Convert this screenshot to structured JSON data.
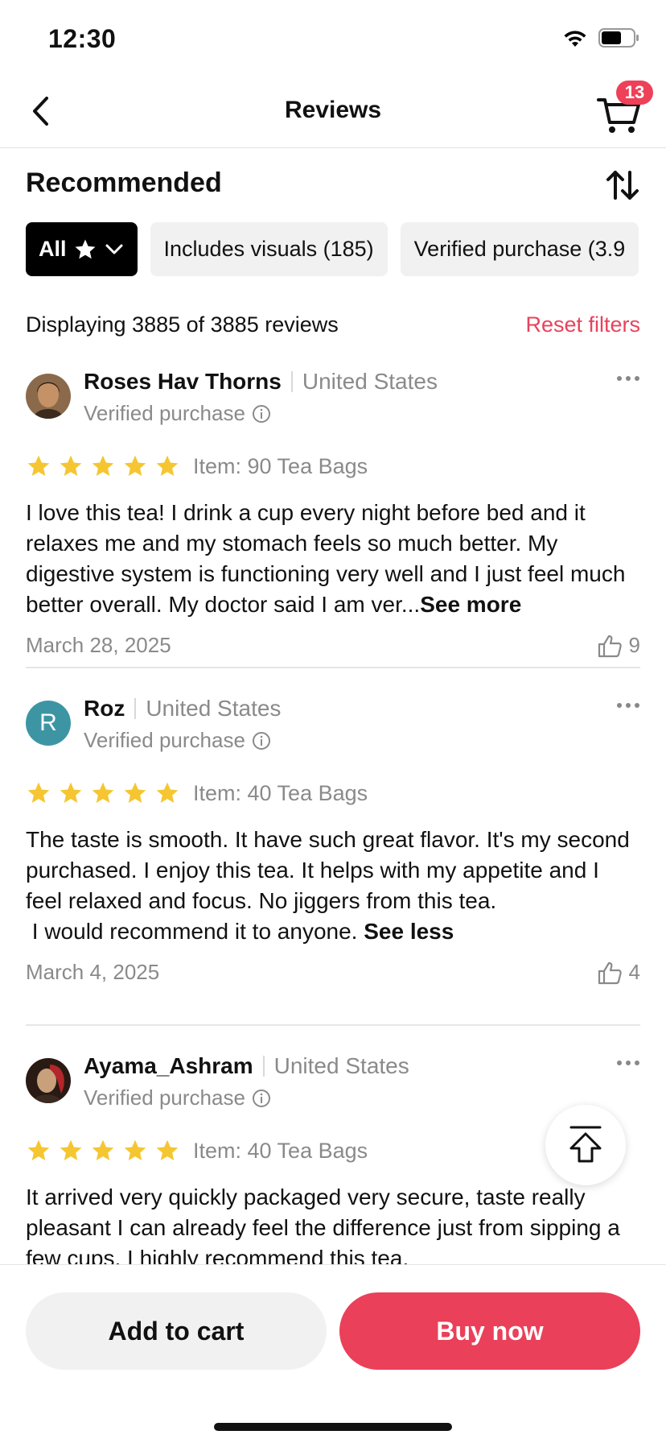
{
  "status": {
    "time": "12:30"
  },
  "nav": {
    "title": "Reviews",
    "cart_count": "13"
  },
  "sort": {
    "title": "Recommended"
  },
  "filters": [
    {
      "label": "All",
      "active": true
    },
    {
      "label": "Includes visuals (185)",
      "active": false
    },
    {
      "label": "Verified purchase (3.9",
      "active": false
    }
  ],
  "summary": {
    "text": "Displaying 3885 of 3885 reviews",
    "reset_label": "Reset filters"
  },
  "reviews": [
    {
      "name": "Roses Hav Thorns",
      "country": "United States",
      "verified": "Verified purchase",
      "rating": 5,
      "item": "Item: 90 Tea Bags",
      "text": "I love this tea! I drink a cup every night before bed and it relaxes me and my stomach feels so much better. My digestive system is functioning very well and I just feel much better overall. My doctor said I am ver...",
      "toggle": "See more",
      "date": "March 28, 2025",
      "likes": "9"
    },
    {
      "name": "Roz",
      "avatar_letter": "R",
      "country": "United States",
      "verified": "Verified purchase",
      "rating": 5,
      "item": "Item: 40 Tea Bags",
      "text_lines": [
        "The taste is smooth. It have such great flavor. It's my second purchased. I enjoy this tea.  It helps with my appetite  and I feel relaxed  and focus. No jiggers from this tea.",
        " I would recommend it to anyone. "
      ],
      "toggle": "See less",
      "date": "March 4, 2025",
      "likes": "4"
    },
    {
      "name": "Ayama_Ashram",
      "country": "United States",
      "verified": "Verified purchase",
      "rating": 5,
      "item": "Item: 40 Tea Bags",
      "text": "It arrived very quickly packaged very secure, taste really pleasant I can already feel the difference just from sipping a few cups, I highly recommend this tea."
    }
  ],
  "actions": {
    "add_to_cart": "Add to cart",
    "buy_now": "Buy now"
  },
  "colors": {
    "accent": "#ea4059",
    "star": "#f5c631",
    "avatar_teal": "#3d95a4"
  }
}
